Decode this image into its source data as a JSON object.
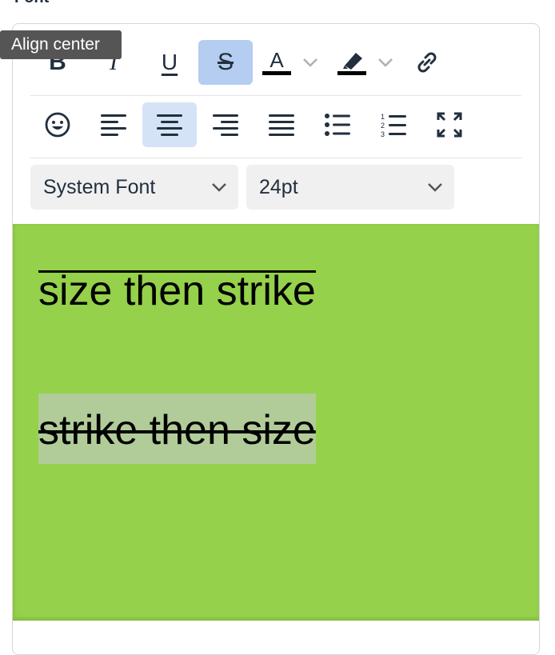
{
  "section_label": "Font",
  "tooltip": "Align center",
  "toolbar": {
    "row1": [
      {
        "name": "bold-button",
        "icon": "bold-icon",
        "glyph": "B"
      },
      {
        "name": "italic-button",
        "icon": "italic-icon",
        "glyph": "I"
      },
      {
        "name": "underline-button",
        "icon": "underline-icon",
        "glyph": "U"
      },
      {
        "name": "strikethrough-button",
        "icon": "strikethrough-icon",
        "glyph": "S",
        "active": true
      },
      {
        "name": "text-color-button",
        "icon": "text-color-icon",
        "glyph": "A"
      },
      {
        "name": "highlight-color-button",
        "icon": "highlighter-icon"
      },
      {
        "name": "link-button",
        "icon": "link-icon"
      }
    ],
    "row2": [
      {
        "name": "emoji-button",
        "icon": "emoji-icon"
      },
      {
        "name": "align-left-button",
        "icon": "align-left-icon"
      },
      {
        "name": "align-center-button",
        "icon": "align-center-icon",
        "active": true
      },
      {
        "name": "align-right-button",
        "icon": "align-right-icon"
      },
      {
        "name": "justify-button",
        "icon": "justify-icon"
      },
      {
        "name": "bullet-list-button",
        "icon": "bullet-list-icon"
      },
      {
        "name": "numbered-list-button",
        "icon": "numbered-list-icon"
      },
      {
        "name": "fullscreen-button",
        "icon": "fullscreen-icon"
      }
    ],
    "font_family": "System Font",
    "font_size": "24pt"
  },
  "content": {
    "background_color": "#95d14a",
    "paragraph1": "size then strike",
    "paragraph2": "strike then size"
  },
  "colors": {
    "active_button": "#b4cdf0",
    "hover_button": "#d5e3f7",
    "selection_highlight": "#b1cc98",
    "icon": "#222f3e"
  }
}
